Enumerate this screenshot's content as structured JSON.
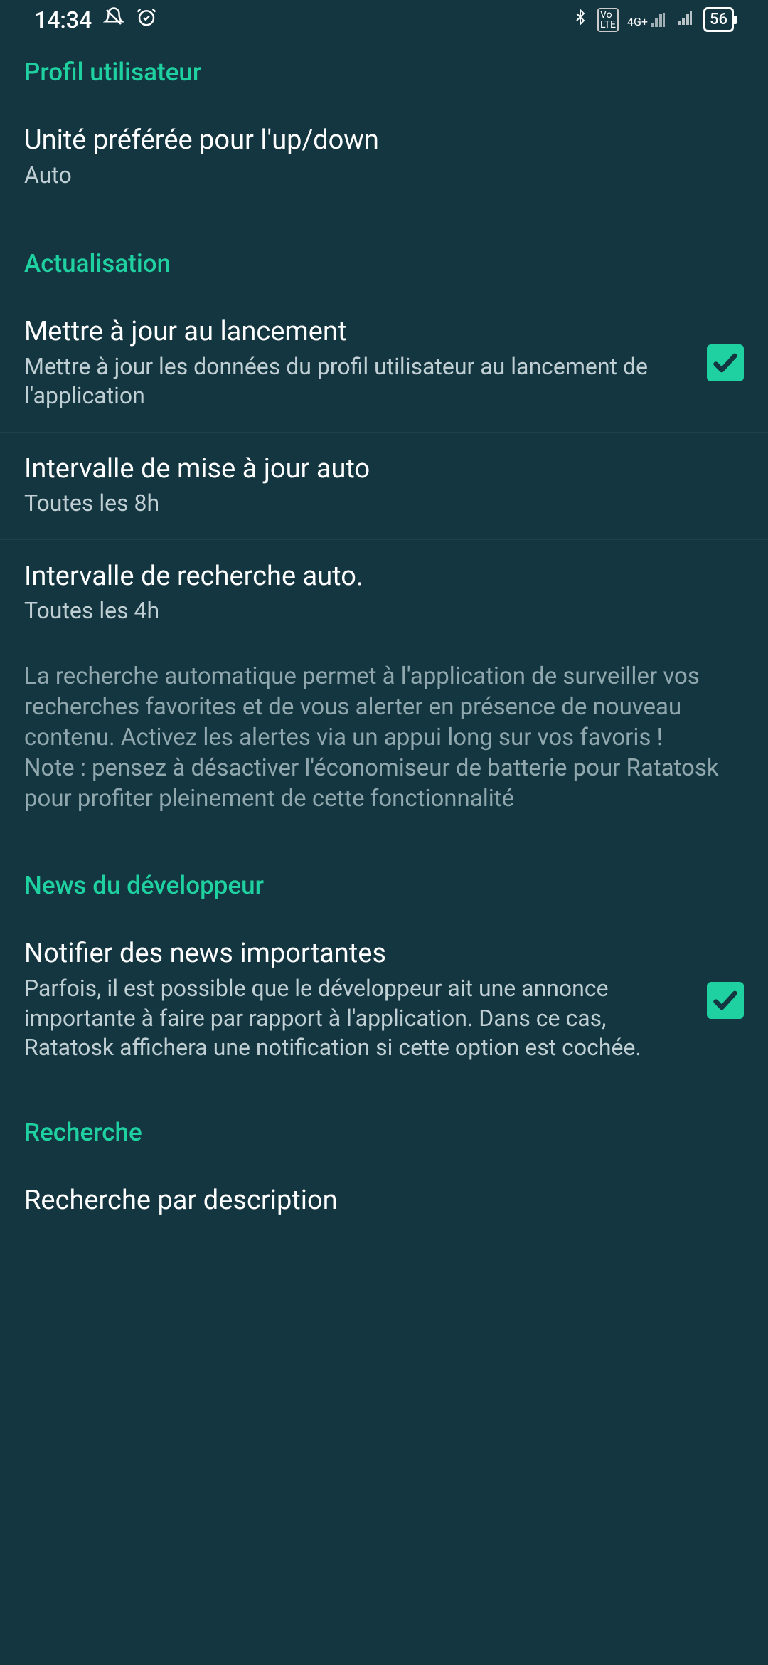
{
  "status": {
    "time": "14:34",
    "battery": "56"
  },
  "sections": {
    "profile": {
      "header": "Profil utilisateur",
      "unit": {
        "title": "Unité préférée pour l'up/down",
        "value": "Auto"
      }
    },
    "refresh": {
      "header": "Actualisation",
      "onLaunch": {
        "title": "Mettre à jour au lancement",
        "sub": "Mettre à jour les données du profil utilisateur au lancement de l'application"
      },
      "updateInterval": {
        "title": "Intervalle de mise à jour auto",
        "value": "Toutes les 8h"
      },
      "searchInterval": {
        "title": "Intervalle de recherche auto.",
        "value": "Toutes les 4h"
      },
      "info": "La recherche automatique permet à l'application de surveiller vos recherches favorites et de vous alerter en présence de nouveau contenu. Activez les alertes via un appui long sur vos favoris !\nNote : pensez à désactiver l'économiseur de batterie pour Ratatosk pour profiter pleinement de cette fonctionnalité"
    },
    "devnews": {
      "header": "News du développeur",
      "notify": {
        "title": "Notifier des news importantes",
        "sub": "Parfois, il est possible que le développeur ait une annonce importante à faire par rapport à l'application. Dans ce cas, Ratatosk affichera une notification si cette option est cochée."
      }
    },
    "search": {
      "header": "Recherche",
      "byDescription": {
        "title": "Recherche par description"
      }
    }
  }
}
